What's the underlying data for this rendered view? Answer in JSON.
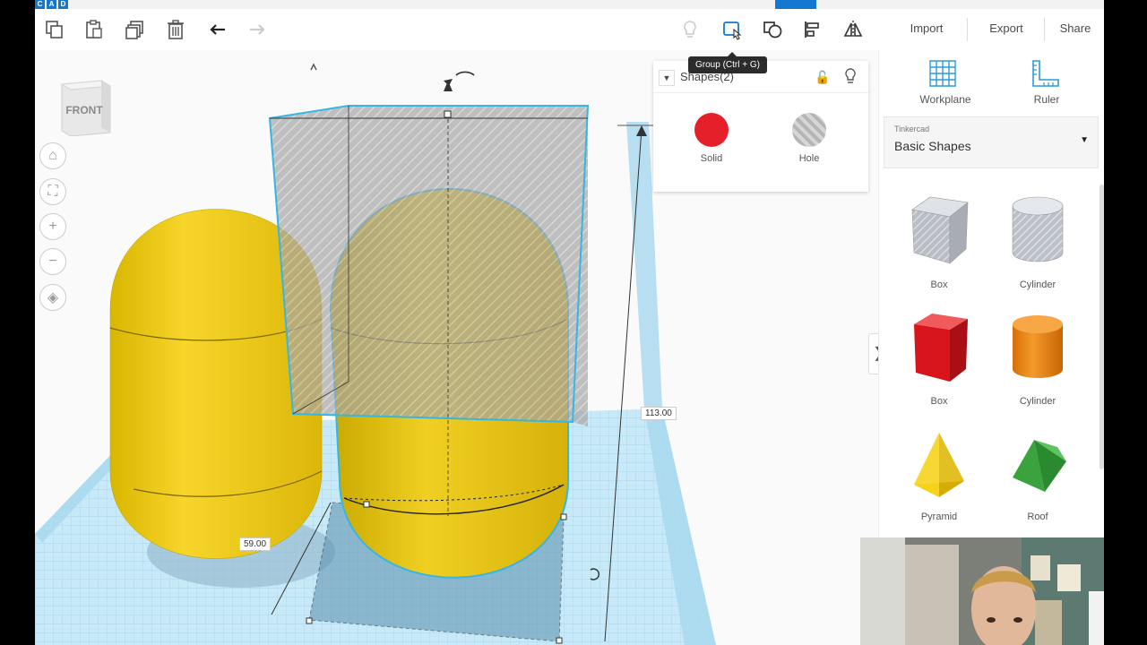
{
  "app": {
    "logo_letters": [
      "C",
      "A",
      "D"
    ]
  },
  "toolbar": {
    "left_icons": [
      "copy-icon",
      "paste-icon",
      "duplicate-icon",
      "delete-icon",
      "undo-icon",
      "redo-icon"
    ],
    "right_icons": [
      "lightbulb-icon",
      "group-icon",
      "ungroup-icon",
      "align-icon",
      "mirror-icon"
    ]
  },
  "topright": {
    "import_label": "Import",
    "export_label": "Export",
    "share_label": "Share"
  },
  "tooltip": {
    "text": "Group (Ctrl + G)"
  },
  "viewcube": {
    "label": "FRONT"
  },
  "shapes_panel": {
    "title": "Shapes(2)",
    "solid_label": "Solid",
    "hole_label": "Hole",
    "solid_color": "#e5202a"
  },
  "dimensions": {
    "height": "113.00",
    "width": "59.00"
  },
  "sidebar": {
    "workplane_label": "Workplane",
    "ruler_label": "Ruler",
    "library_provider": "Tinkercad",
    "library_name": "Basic Shapes",
    "shapes": [
      {
        "label": "Box",
        "kind": "box-hole"
      },
      {
        "label": "Cylinder",
        "kind": "cylinder-hole"
      },
      {
        "label": "Box",
        "kind": "box-red"
      },
      {
        "label": "Cylinder",
        "kind": "cylinder-orange"
      },
      {
        "label": "Pyramid",
        "kind": "pyramid-yellow"
      },
      {
        "label": "Roof",
        "kind": "roof-green"
      }
    ]
  },
  "colors": {
    "accent": "#1477d1",
    "grid": "#bde3f4",
    "capsule": "#f2cd1a",
    "box": "#e5202a",
    "cylinder": "#ee8514",
    "pyramid": "#f5d21c",
    "roof": "#3aa33e"
  }
}
